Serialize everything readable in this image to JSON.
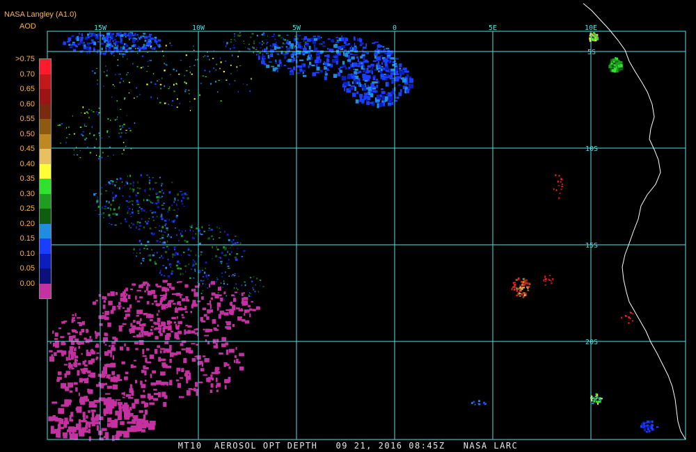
{
  "header": {
    "title": "NASA Langley (A1.0)",
    "subtitle": "AOD"
  },
  "legend": {
    "labels": [
      ">0.75",
      "0.70",
      "0.65",
      "0.60",
      "0.55",
      "0.50",
      "0.45",
      "0.40",
      "0.35",
      "0.30",
      "0.25",
      "0.20",
      "0.15",
      "0.10",
      "0.05",
      "0.00"
    ],
    "colors": [
      "#ff1b2b",
      "#c21a1a",
      "#9d1414",
      "#7a2a0e",
      "#8e5a12",
      "#c08820",
      "#e8c062",
      "#ffff33",
      "#2ee22e",
      "#1e9d1e",
      "#0f5e0f",
      "#1e8ee0",
      "#1a3eff",
      "#0a1fbe",
      "#0a117a",
      "#c431a0"
    ]
  },
  "map": {
    "lon_ticks": [
      {
        "label": "15W",
        "lon": -15
      },
      {
        "label": "10W",
        "lon": -10
      },
      {
        "label": "5W",
        "lon": -5
      },
      {
        "label": "0",
        "lon": 0
      },
      {
        "label": "5E",
        "lon": 5
      },
      {
        "label": "10E",
        "lon": 10
      }
    ],
    "lat_ticks": [
      {
        "label": "5S",
        "lat": -5
      },
      {
        "label": "10S",
        "lat": -10
      },
      {
        "label": "15S",
        "lat": -15
      },
      {
        "label": "20S",
        "lat": -20
      }
    ],
    "grid_color": "#4ee3e3",
    "coast_color": "#ffffff"
  },
  "footer": {
    "text": "MT10  AEROSOL OPT DEPTH   09 21, 2016 08:45Z   NASA LARC"
  }
}
